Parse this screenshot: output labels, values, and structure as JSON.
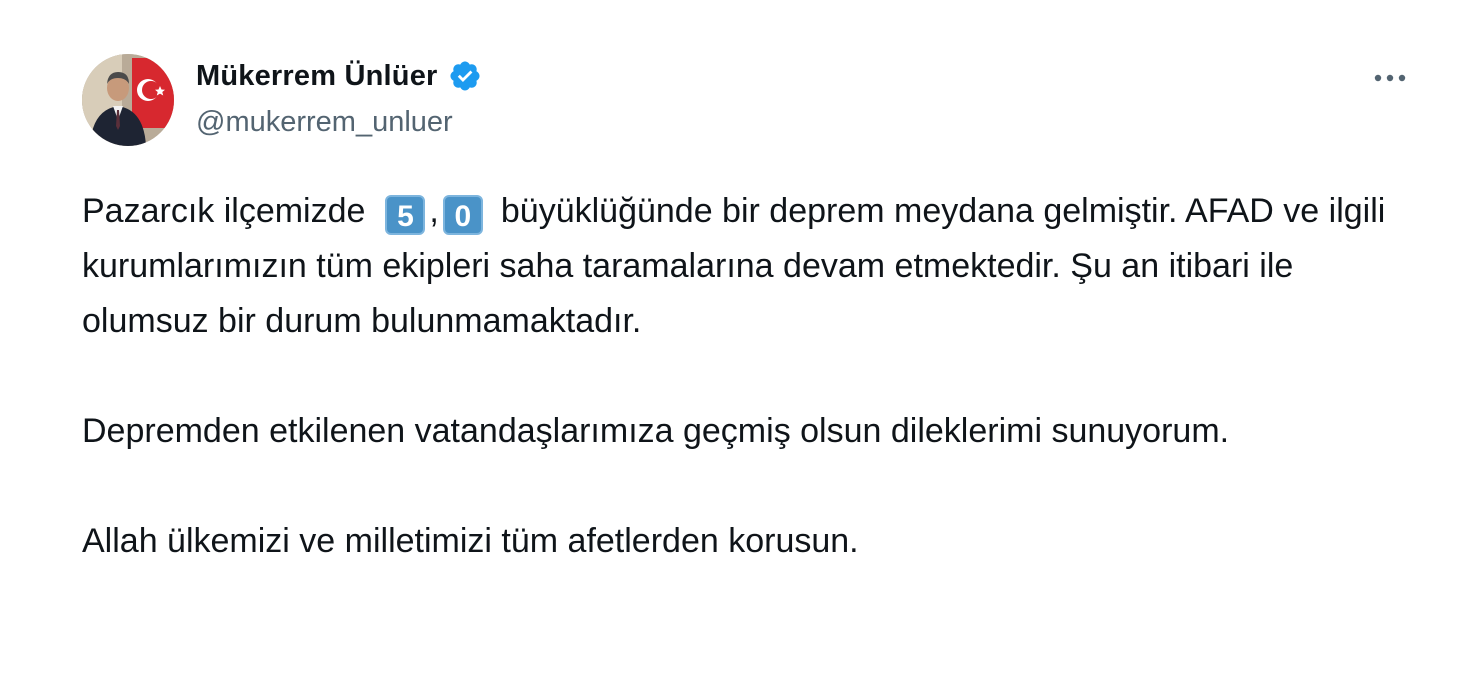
{
  "author": {
    "display_name": "Mükerrem Ünlüer",
    "handle": "@mukerrem_unluer",
    "verified": true,
    "verified_icon": "verified-badge-icon",
    "avatar": "profile-photo"
  },
  "menu": {
    "icon": "more-options-icon",
    "label": "···"
  },
  "tweet": {
    "p1_before": "Pazarcık ilçemizde",
    "magnitude_digit_1": "5",
    "magnitude_separator": ",",
    "magnitude_digit_2": "0",
    "p1_after": "büyüklüğünde bir deprem meydana gelmiştir. AFAD ve ilgili kurumlarımızın tüm ekipleri saha taramalarına devam etmektedir. Şu an itibari ile olumsuz bir durum bulunmamaktadır.",
    "p2": "Depremden etkilenen vatandaşlarımıza geçmiş olsun dileklerimi sunuyorum.",
    "p3": "Allah ülkemizi ve milletimizi tüm afetlerden korusun."
  },
  "colors": {
    "verified_blue": "#1d9bf0",
    "keycap_blue": "#4a93c8",
    "handle_gray": "#536471",
    "text": "#0f1419"
  }
}
